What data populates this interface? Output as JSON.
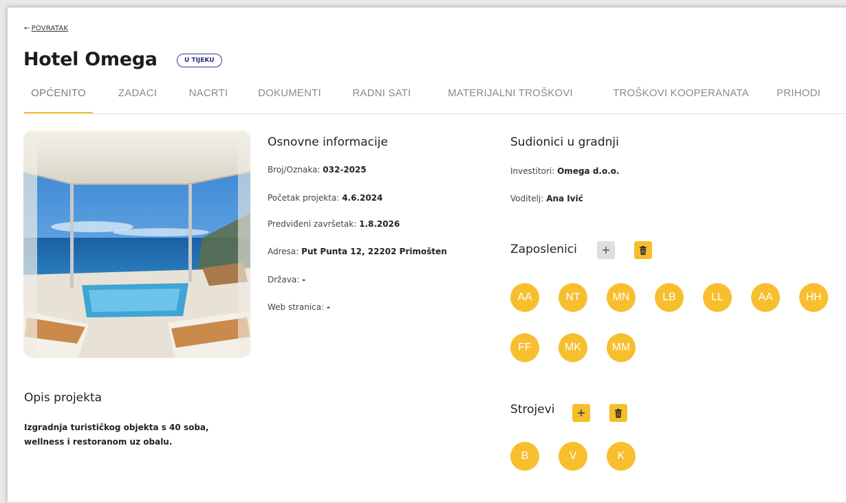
{
  "header": {
    "back_label": "POVRATAK",
    "title": "Hotel Omega",
    "status": "U TIJEKU"
  },
  "tabs": [
    {
      "label": "OPĆENITO"
    },
    {
      "label": "ZADACI"
    },
    {
      "label": "NACRTI"
    },
    {
      "label": "DOKUMENTI"
    },
    {
      "label": "RADNI SATI"
    },
    {
      "label": "MATERIJALNI TROŠKOVI"
    },
    {
      "label": "TROŠKOVI KOOPERANATA"
    },
    {
      "label": "PRIHODI"
    }
  ],
  "basic_info": {
    "title": "Osnovne informacije",
    "rows": [
      {
        "label": "Broj/Oznaka:",
        "value": "032-2025"
      },
      {
        "label": "Početak projekta:",
        "value": "4.6.2024"
      },
      {
        "label": "Predviđeni završetak:",
        "value": "1.8.2026"
      },
      {
        "label": "Adresa:",
        "value": "Put Punta 12, 22202 Primošten"
      },
      {
        "label": "Država:",
        "value": "-"
      },
      {
        "label": "Web stranica:",
        "value": "-"
      }
    ]
  },
  "participants": {
    "title": "Sudionici u gradnji",
    "investors_label": "Investitori:",
    "investors_value": "Omega d.o.o.",
    "manager_label": "Voditelj:",
    "manager_value": "Ana Ivić"
  },
  "employees": {
    "title": "Zaposlenici",
    "add_icon": "plus-icon",
    "delete_icon": "trash-icon",
    "avatars": [
      "AA",
      "NT",
      "MN",
      "LB",
      "LL",
      "AA",
      "HH",
      "FF",
      "MK",
      "MM"
    ]
  },
  "machines": {
    "title": "Strojevi",
    "add_icon": "plus-icon",
    "delete_icon": "trash-icon",
    "avatars": [
      "B",
      "V",
      "K"
    ]
  },
  "description": {
    "title": "Opis projekta",
    "text": "Izgradnja turističkog objekta s 40 soba, wellness i restoranom uz obalu."
  },
  "colors": {
    "accent": "#f5bf2a",
    "status_border": "#3b3f8f",
    "avatar": "#f7be2e"
  }
}
